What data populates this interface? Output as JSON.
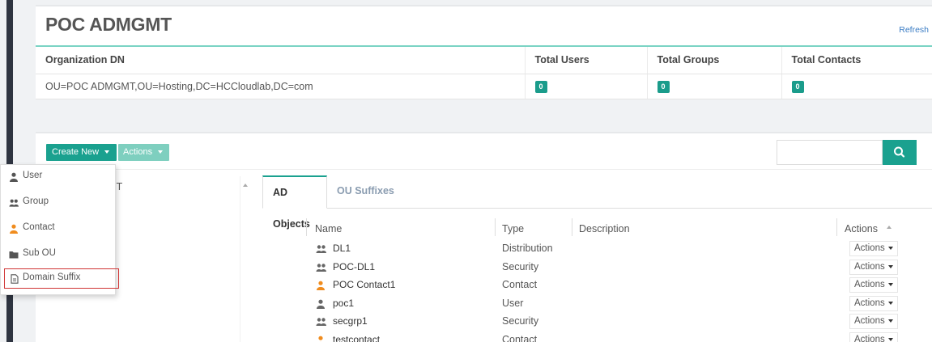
{
  "header": {
    "title": "POC ADMGMT",
    "refresh_label": "Refresh"
  },
  "org_table": {
    "columns": [
      "Organization DN",
      "Total Users",
      "Total Groups",
      "Total Contacts"
    ],
    "row": {
      "dn": "OU=POC ADMGMT,OU=Hosting,DC=HCCloudlab,DC=com",
      "total_users": "0",
      "total_groups": "0",
      "total_contacts": "0"
    }
  },
  "toolbar": {
    "create_new_label": "Create New",
    "actions_label": "Actions",
    "search_value": ""
  },
  "tree": {
    "root_label": "POC ADMGMT",
    "root_visible_fragment": "DMGMT"
  },
  "tabs": [
    {
      "label": "AD Objects",
      "active": true
    },
    {
      "label": "OU Suffixes",
      "active": false
    }
  ],
  "objects_table": {
    "columns": {
      "name": "Name",
      "type": "Type",
      "description": "Description",
      "actions": "Actions"
    },
    "rows": [
      {
        "name": "DL1",
        "type": "Distribution",
        "icon": "group-icon",
        "action_label": "Actions"
      },
      {
        "name": "POC-DL1",
        "type": "Security",
        "icon": "group-icon",
        "action_label": "Actions"
      },
      {
        "name": "POC Contact1",
        "type": "Contact",
        "icon": "contact-icon",
        "action_label": "Actions"
      },
      {
        "name": "poc1",
        "type": "User",
        "icon": "user-icon",
        "action_label": "Actions"
      },
      {
        "name": "secgrp1",
        "type": "Security",
        "icon": "group-icon",
        "action_label": "Actions"
      },
      {
        "name": "testcontact",
        "type": "Contact",
        "icon": "contact-icon",
        "action_label": "Actions"
      }
    ]
  },
  "create_menu": {
    "items": [
      {
        "label": "User",
        "icon": "user-icon"
      },
      {
        "label": "Group",
        "icon": "group-icon"
      },
      {
        "label": "Contact",
        "icon": "contact-icon"
      },
      {
        "label": "Sub OU",
        "icon": "folder-icon"
      },
      {
        "label": "Domain Suffix",
        "icon": "document-icon",
        "highlighted": true
      }
    ]
  },
  "colors": {
    "accent": "#1aa18f",
    "accent_light": "#7ecfbf",
    "contact_orange": "#f08c1e",
    "highlight_border": "#d03535"
  }
}
